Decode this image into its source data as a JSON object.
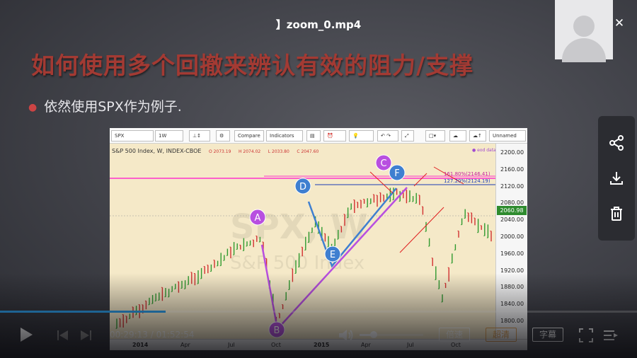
{
  "window": {
    "title": "】zoom_0.mp4"
  },
  "slide": {
    "heading": "如何使用多个回撤来辨认有效的阻力/支撑",
    "bullet": "依然使用SPX作为例子."
  },
  "chart": {
    "toolbar": {
      "symbol": "SPX",
      "interval": "1W",
      "compare_label": "Compare",
      "indicators_label": "Indicators",
      "layout_name": "Unnamed"
    },
    "legend": {
      "title": "S&P 500 Index, W, INDEX-CBOE",
      "o": "O 2073.19",
      "h": "H 2074.02",
      "l": "L 2033.80",
      "c": "C 2047.60"
    },
    "eod_label": "● eod data",
    "fib_levels": [
      "161.80%(2146.41)",
      "127.20%(2124.19)"
    ],
    "last_price": "2060.98",
    "price_ticks": [
      "2200.00",
      "2160.00",
      "2120.00",
      "2080.00",
      "2040.00",
      "2000.00",
      "1960.00",
      "1920.00",
      "1880.00",
      "1840.00",
      "1800.00"
    ],
    "time_ticks": [
      "2014",
      "Apr",
      "Jul",
      "Oct",
      "2015",
      "Apr",
      "Jul",
      "Oct"
    ],
    "watermark": "SPX, W",
    "watermark_sub": "S&P 500 Index",
    "points": [
      "A",
      "B",
      "C",
      "D",
      "E",
      "F"
    ],
    "colors": {
      "up": "#2f9a2f",
      "down": "#d23030",
      "purple": "#b84fe0",
      "blue_point": "#3f7fd0",
      "magenta_line": "#ff33cc"
    }
  },
  "player": {
    "current_time": "00:29:13",
    "total_time": "01:52:54",
    "time_separator": " / ",
    "progress": 0.26,
    "volume": 0.22,
    "speed_label": "倍速",
    "quality_label": "超清",
    "subtitle_label": "字幕",
    "accent": "#2b9be6"
  },
  "side_panel": {
    "icons": [
      "share-icon",
      "download-icon",
      "delete-icon"
    ]
  }
}
